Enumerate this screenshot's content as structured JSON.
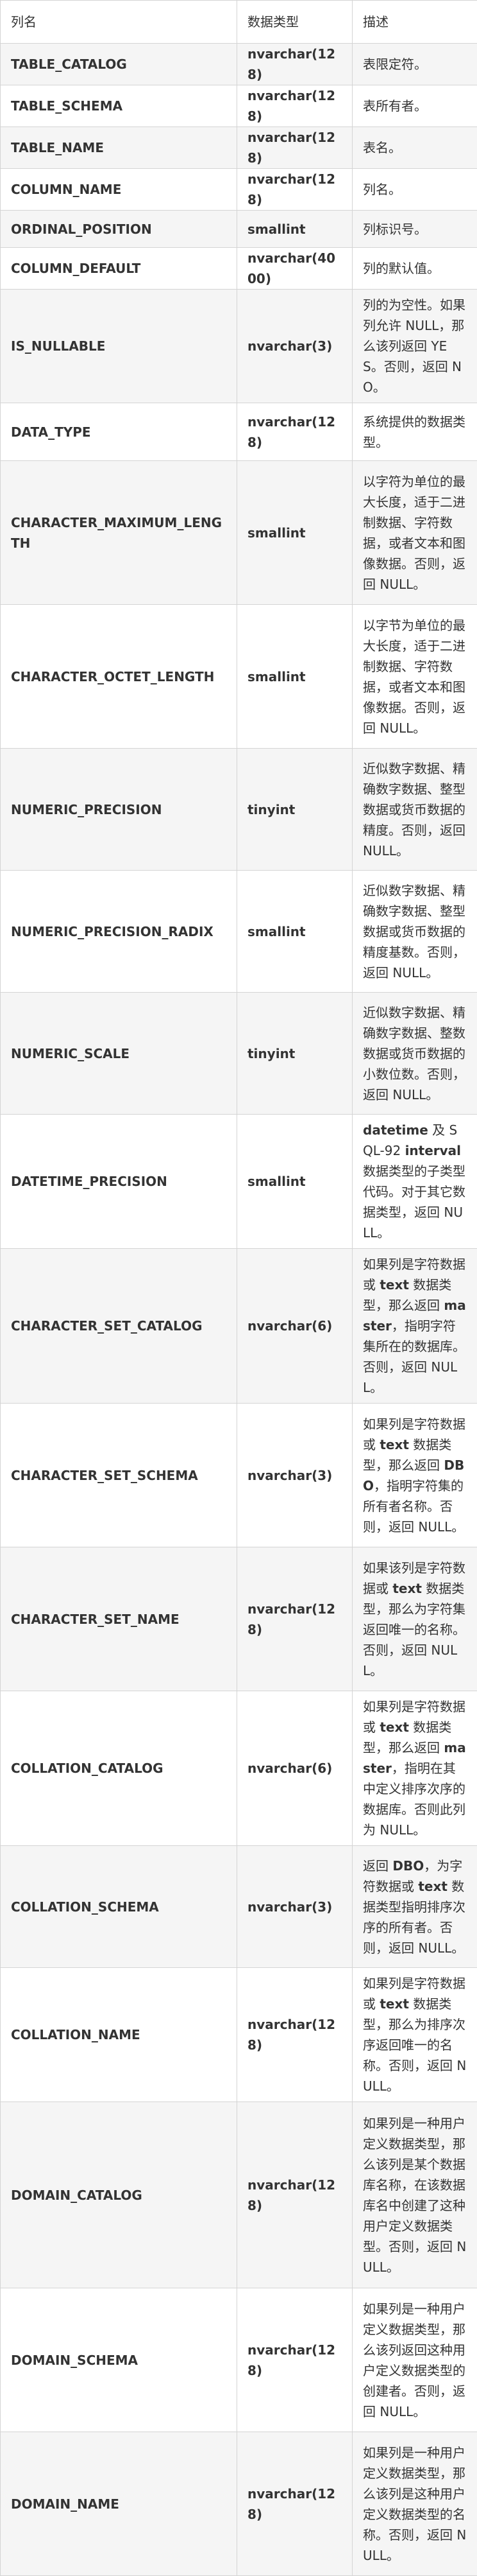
{
  "headers": [
    "列名",
    "数据类型",
    "描述"
  ],
  "rows": [
    {
      "name": "TABLE_CATALOG",
      "type": "nvarchar(128)",
      "desc": [
        {
          "t": "表限定符。"
        }
      ]
    },
    {
      "name": "TABLE_SCHEMA",
      "type": "nvarchar(128)",
      "desc": [
        {
          "t": "表所有者。"
        }
      ]
    },
    {
      "name": "TABLE_NAME",
      "type": "nvarchar(128)",
      "desc": [
        {
          "t": "表名。"
        }
      ]
    },
    {
      "name": "COLUMN_NAME",
      "type": "nvarchar(128)",
      "desc": [
        {
          "t": "列名。"
        }
      ]
    },
    {
      "name": "ORDINAL_POSITION",
      "type": "smallint",
      "desc": [
        {
          "t": "列标识号。"
        }
      ]
    },
    {
      "name": "COLUMN_DEFAULT",
      "type": "nvarchar(4000)",
      "desc": [
        {
          "t": "列的默认值。"
        }
      ]
    },
    {
      "name": "IS_NULLABLE",
      "type": "nvarchar(3)",
      "desc": [
        {
          "t": "列的为空性。如果列允许 NULL，那么该列返回 YES。否则，返回 NO。"
        }
      ]
    },
    {
      "name": "DATA_TYPE",
      "type": "nvarchar(128)",
      "desc": [
        {
          "t": "系统提供的数据类型。"
        }
      ]
    },
    {
      "name": "CHARACTER_MAXIMUM_LENGTH",
      "type": "smallint",
      "desc": [
        {
          "t": "以字符为单位的最大长度，适于二进制数据、字符数据，或者文本和图像数据。否则，返回 NULL。"
        }
      ]
    },
    {
      "name": "CHARACTER_OCTET_LENGTH",
      "type": "smallint",
      "desc": [
        {
          "t": "以字节为单位的最大长度，适于二进制数据、字符数据，或者文本和图像数据。否则，返回 NULL。"
        }
      ]
    },
    {
      "name": "NUMERIC_PRECISION",
      "type": "tinyint",
      "desc": [
        {
          "t": "近似数字数据、精确数字数据、整型数据或货币数据的精度。否则，返回 NULL。"
        }
      ]
    },
    {
      "name": "NUMERIC_PRECISION_RADIX",
      "type": "smallint",
      "desc": [
        {
          "t": "近似数字数据、精确数字数据、整型数据或货币数据的精度基数。否则，返回 NULL。"
        }
      ]
    },
    {
      "name": "NUMERIC_SCALE",
      "type": "tinyint",
      "desc": [
        {
          "t": "近似数字数据、精确数字数据、整数数据或货币数据的小数位数。否则，返回 NULL。"
        }
      ]
    },
    {
      "name": "DATETIME_PRECISION",
      "type": "smallint",
      "desc": [
        {
          "t": "datetime",
          "b": true
        },
        {
          "t": " 及 SQL-92 "
        },
        {
          "t": "interval",
          "b": true
        },
        {
          "t": " 数据类型的子类型代码。对于其它数据类型，返回 NULL。"
        }
      ]
    },
    {
      "name": "CHARACTER_SET_CATALOG",
      "type": "nvarchar(6)",
      "desc": [
        {
          "t": "如果列是字符数据或 "
        },
        {
          "t": "text",
          "b": true
        },
        {
          "t": " 数据类型，那么返回 "
        },
        {
          "t": "master",
          "b": true
        },
        {
          "t": "，指明字符集所在的数据库。否则，返回 NULL。"
        }
      ]
    },
    {
      "name": "CHARACTER_SET_SCHEMA",
      "type": "nvarchar(3)",
      "desc": [
        {
          "t": "如果列是字符数据或 "
        },
        {
          "t": "text",
          "b": true
        },
        {
          "t": " 数据类型，那么返回 "
        },
        {
          "t": "DBO",
          "b": true
        },
        {
          "t": "，指明字符集的所有者名称。否则，返回 NULL。"
        }
      ]
    },
    {
      "name": "CHARACTER_SET_NAME",
      "type": "nvarchar(128)",
      "desc": [
        {
          "t": "如果该列是字符数据或 "
        },
        {
          "t": "text",
          "b": true
        },
        {
          "t": " 数据类型，那么为字符集返回唯一的名称。否则，返回 NULL。"
        }
      ]
    },
    {
      "name": "COLLATION_CATALOG",
      "type": "nvarchar(6)",
      "desc": [
        {
          "t": "如果列是字符数据或 "
        },
        {
          "t": "text",
          "b": true
        },
        {
          "t": " 数据类型，那么返回 "
        },
        {
          "t": "master",
          "b": true
        },
        {
          "t": "，指明在其中定义排序次序的数据库。否则此列为 NULL。"
        }
      ]
    },
    {
      "name": "COLLATION_SCHEMA",
      "type": "nvarchar(3)",
      "desc": [
        {
          "t": "返回 "
        },
        {
          "t": "DBO",
          "b": true
        },
        {
          "t": "，为字符数据或 "
        },
        {
          "t": "text",
          "b": true
        },
        {
          "t": " 数据类型指明排序次序的所有者。否则，返回 NULL。"
        }
      ]
    },
    {
      "name": "COLLATION_NAME",
      "type": "nvarchar(128)",
      "desc": [
        {
          "t": "如果列是字符数据或 "
        },
        {
          "t": "text",
          "b": true
        },
        {
          "t": " 数据类型，那么为排序次序返回唯一的名称。否则，返回 NULL。"
        }
      ]
    },
    {
      "name": "DOMAIN_CATALOG",
      "type": "nvarchar(128)",
      "desc": [
        {
          "t": "如果列是一种用户定义数据类型，那么该列是某个数据库名称，在该数据库名中创建了这种用户定义数据类型。否则，返回 NULL。"
        }
      ]
    },
    {
      "name": "DOMAIN_SCHEMA",
      "type": "nvarchar(128)",
      "desc": [
        {
          "t": "如果列是一种用户定义数据类型，那么该列返回这种用户定义数据类型的创建者。否则，返回 NULL。"
        }
      ]
    },
    {
      "name": "DOMAIN_NAME",
      "type": "nvarchar(128)",
      "desc": [
        {
          "t": "如果列是一种用户定义数据类型，那么该列是这种用户定义数据类型的名称。否则，返回 NULL。"
        }
      ]
    }
  ]
}
